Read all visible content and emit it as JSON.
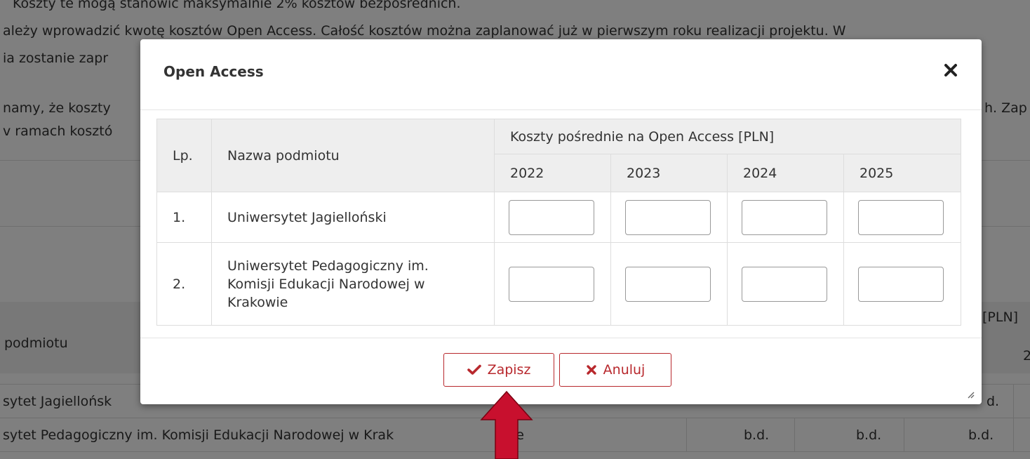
{
  "background": {
    "lines": [
      "Koszty te mogą stanowić maksymalnie 2% kosztów bezpośrednich.",
      "ależy wprowadzić kwotę kosztów Open Access. Całość kosztów można zaplanować już w pierwszym roku realizacji projektu. W",
      "ia zostanie zapr",
      "namy, że koszty",
      "v ramach kosztó"
    ],
    "line_right_fragment": "h. Zap",
    "table_header_partial": "podmiotu",
    "table_header_right": "[PLN]",
    "table_header_right2": "2",
    "rows": [
      {
        "name": "sytet Jagiellońsk",
        "val": "d."
      },
      {
        "name": "sytet Pedagogiczny im. Komisji Edukacji Narodowej w Krak",
        "name_tail": "ie",
        "values": [
          "b.d.",
          "b.d.",
          "b.d."
        ]
      }
    ]
  },
  "dialog": {
    "title": "Open Access",
    "close_icon": "close-icon",
    "table": {
      "col_lp": "Lp.",
      "col_name": "Nazwa podmiotu",
      "col_group": "Koszty pośrednie na Open Access [PLN]",
      "years": [
        "2022",
        "2023",
        "2024",
        "2025"
      ],
      "rows": [
        {
          "lp": "1.",
          "name": "Uniwersytet Jagielloński"
        },
        {
          "lp": "2.",
          "name_lines": [
            "Uniwersytet Pedagogiczny im.",
            "Komisji Edukacji Narodowej w",
            "Krakowie"
          ]
        }
      ]
    },
    "buttons": {
      "save": "Zapisz",
      "cancel": "Anuluj"
    }
  },
  "colors": {
    "accent": "#b8282d",
    "arrow": "#c8102e"
  }
}
